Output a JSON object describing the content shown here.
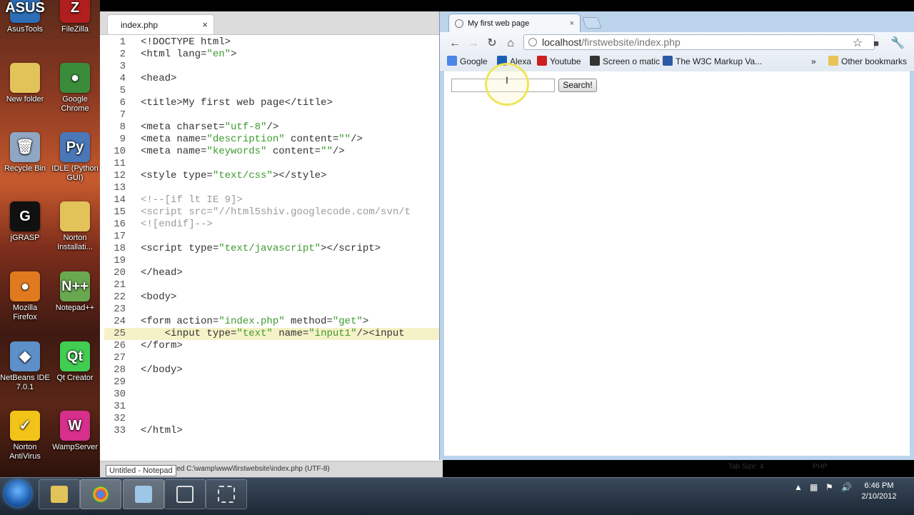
{
  "desktop": {
    "icons": [
      {
        "label": "AsusTools",
        "color": "#2d6db5",
        "glyph": "ASUS"
      },
      {
        "label": "FileZilla",
        "color": "#b11e1e",
        "glyph": "Z"
      },
      {
        "label": "New folder",
        "color": "#e2c35a",
        "glyph": ""
      },
      {
        "label": "Google Chrome",
        "color": "#3a8c3a",
        "glyph": "●"
      },
      {
        "label": "Recycle Bin",
        "color": "#8fa7c2",
        "glyph": "🗑"
      },
      {
        "label": "IDLE (Python GUI)",
        "color": "#4a77b8",
        "glyph": "Py"
      },
      {
        "label": "jGRASP",
        "color": "#111111",
        "glyph": "G"
      },
      {
        "label": "Norton Installati...",
        "color": "#e2c35a",
        "glyph": ""
      },
      {
        "label": "Mozilla Firefox",
        "color": "#e07a1f",
        "glyph": "●"
      },
      {
        "label": "Notepad++",
        "color": "#6aa84f",
        "glyph": "N++"
      },
      {
        "label": "NetBeans IDE 7.0.1",
        "color": "#5d8fc9",
        "glyph": "◆"
      },
      {
        "label": "Qt Creator",
        "color": "#41cd52",
        "glyph": "Qt"
      },
      {
        "label": "Norton AntiVirus",
        "color": "#f2c318",
        "glyph": "✓"
      },
      {
        "label": "WampServer",
        "color": "#d62f8c",
        "glyph": "W"
      }
    ]
  },
  "editor": {
    "tab_title": "index.php",
    "tab_close": "×",
    "current_line": 25,
    "lines": [
      {
        "n": "1",
        "html": "&lt;!DOCTYPE html&gt;"
      },
      {
        "n": "2",
        "html": "&lt;html lang=<span class=\"s\">\"en\"</span>&gt;"
      },
      {
        "n": "3",
        "html": ""
      },
      {
        "n": "4",
        "html": "&lt;head&gt;"
      },
      {
        "n": "5",
        "html": ""
      },
      {
        "n": "6",
        "html": "&lt;title&gt;My first web page&lt;/title&gt;"
      },
      {
        "n": "7",
        "html": ""
      },
      {
        "n": "8",
        "html": "&lt;meta charset=<span class=\"s\">\"utf-8\"</span>/&gt;"
      },
      {
        "n": "9",
        "html": "&lt;meta name=<span class=\"s\">\"description\"</span> content=<span class=\"s\">\"\"</span>/&gt;"
      },
      {
        "n": "10",
        "html": "&lt;meta name=<span class=\"s\">\"keywords\"</span> content=<span class=\"s\">\"\"</span>/&gt;"
      },
      {
        "n": "11",
        "html": ""
      },
      {
        "n": "12",
        "html": "&lt;style type=<span class=\"s\">\"text/css\"</span>&gt;&lt;/style&gt;"
      },
      {
        "n": "13",
        "html": ""
      },
      {
        "n": "14",
        "html": "<span class=\"c\">&lt;!--[if lt IE 9]&gt;</span>"
      },
      {
        "n": "15",
        "html": "<span class=\"c\">&lt;script src=\"//html5shiv.googlecode.com/svn/t</span>"
      },
      {
        "n": "16",
        "html": "<span class=\"c\">&lt;![endif]--&gt;</span>"
      },
      {
        "n": "17",
        "html": ""
      },
      {
        "n": "18",
        "html": "&lt;script type=<span class=\"s\">\"text/javascript\"</span>&gt;&lt;/script&gt;"
      },
      {
        "n": "19",
        "html": ""
      },
      {
        "n": "20",
        "html": "&lt;/head&gt;"
      },
      {
        "n": "21",
        "html": ""
      },
      {
        "n": "22",
        "html": "&lt;body&gt;"
      },
      {
        "n": "23",
        "html": ""
      },
      {
        "n": "24",
        "html": "&lt;form action=<span class=\"s\">\"index.php\"</span> method=<span class=\"s\">\"get\"</span>&gt;"
      },
      {
        "n": "25",
        "html": "    &lt;input type=<span class=\"s\">\"text\"</span> name=<span class=\"s\">\"input1\"</span>/&gt;&lt;input"
      },
      {
        "n": "26",
        "html": "&lt;/form&gt;"
      },
      {
        "n": "27",
        "html": ""
      },
      {
        "n": "28",
        "html": "&lt;/body&gt;"
      },
      {
        "n": "29",
        "html": ""
      },
      {
        "n": "30",
        "html": ""
      },
      {
        "n": "31",
        "html": ""
      },
      {
        "n": "32",
        "html": ""
      },
      {
        "n": "33",
        "html": "&lt;/html&gt;"
      }
    ],
    "status_left": "Saved C:\\wamp\\www\\firstwebsite\\index.php (UTF-8)",
    "status_tab_size": "Tab Size: 4",
    "status_syntax": "PHP",
    "tooltip": "Untitled - Notepad"
  },
  "browser": {
    "tab_title": "My first web page",
    "tab_close": "×",
    "url_host": "localhost",
    "url_path": "/firstwebsite/index.php",
    "bookmarks": [
      {
        "label": "Google",
        "color": "#4a86e8"
      },
      {
        "label": "Alexa",
        "color": "#1a5fb4"
      },
      {
        "label": "Youtube",
        "color": "#cc1f1f"
      },
      {
        "label": "Screen o matic",
        "color": "#333333"
      },
      {
        "label": "The W3C Markup Va...",
        "color": "#2b5aa3"
      }
    ],
    "bookmarks_overflow": "»",
    "other_bookmarks": "Other bookmarks",
    "search_value": "",
    "search_button": "Search!"
  },
  "taskbar": {
    "time": "6:46 PM",
    "date": "2/10/2012"
  }
}
